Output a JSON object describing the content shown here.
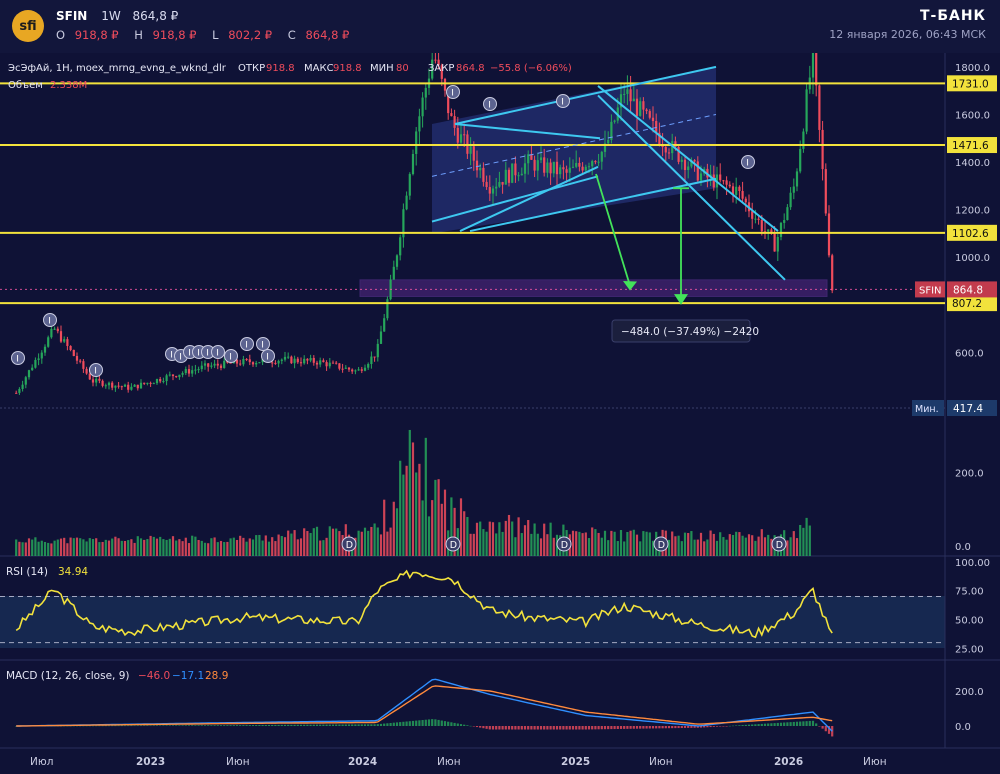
{
  "header": {
    "logo_text": "sfi",
    "symbol": "SFIN",
    "interval": "1W",
    "last_price": "864,8 ₽",
    "ohlc": [
      {
        "key": "O",
        "value": "918,8 ₽"
      },
      {
        "key": "H",
        "value": "918,8 ₽"
      },
      {
        "key": "L",
        "value": "802,2 ₽"
      },
      {
        "key": "C",
        "value": "864,8 ₽"
      }
    ],
    "brand": "Т-БАНК",
    "datetime": "12 января 2026, 06:43 МСК"
  },
  "legend": {
    "symbol_desc": "ЭсЭфАй, 1H, moex_mrng_evng_e_wknd_dlr",
    "open_label": "ОТКР",
    "open": "918.8",
    "high_label": "МАКС",
    "high": "918.8",
    "low_label": "МИН",
    "low": "80",
    "close_label": "ЗАКР",
    "close": "864.8",
    "change": "−55.8 (−6.06%)",
    "volume_label": "Объем",
    "volume": "2.338M"
  },
  "colors": {
    "background": "#0f1236",
    "up": "#26a65b",
    "down": "#ef4c5c",
    "level_line": "#f2e23c",
    "channel": "#3ec8f0",
    "target_arrow": "#43e35a",
    "zone": "#9b3fd4",
    "rsi_line": "#f2e23c",
    "macd_line": "#2f8fff",
    "signal_line": "#ff8a3d"
  },
  "chart_data": [
    {
      "type": "line",
      "title": "",
      "panel": "price",
      "ylim": [
        400,
        1850
      ],
      "y_ticks": [
        600.0,
        800.0,
        1000.0,
        1200.0,
        1400.0,
        1600.0,
        1800.0
      ],
      "x_ticks": [
        "Июл",
        "2023",
        "Июн",
        "2024",
        "Июн",
        "2025",
        "Июн",
        "2026",
        "Июн"
      ],
      "series": [
        {
          "x": [
            "2022-06",
            "2022-08",
            "2022-10",
            "2022-12",
            "2023-02",
            "2023-04",
            "2023-06",
            "2023-08",
            "2023-10",
            "2023-12",
            "2024-01",
            "2024-02",
            "2024-03",
            "2024-04",
            "2024-05",
            "2024-07",
            "2024-09",
            "2024-11",
            "2025-01",
            "2025-02",
            "2025-04",
            "2025-06",
            "2025-08",
            "2025-10",
            "2025-11",
            "2025-12",
            "2026-01"
          ],
          "y": [
            430,
            700,
            480,
            450,
            500,
            540,
            560,
            570,
            560,
            520,
            600,
            1000,
            1500,
            1860,
            1560,
            1300,
            1400,
            1350,
            1450,
            1700,
            1500,
            1350,
            1280,
            1050,
            1300,
            1850,
            864.8
          ]
        }
      ],
      "levels": [
        {
          "value": 1731.0,
          "label": "1731.0"
        },
        {
          "value": 1471.6,
          "label": "1471.6"
        },
        {
          "value": 1102.6,
          "label": "1102.6"
        },
        {
          "value": 807.2,
          "label": "807.2"
        }
      ],
      "last_price_tag": {
        "label": "SFIN",
        "value": 864.8,
        "value_label": "864.8"
      },
      "min_tag": {
        "label": "Мин.",
        "value": 417.4,
        "value_label": "417.4"
      },
      "measure_label": "−484.0 (−37.49%) −2420",
      "event_markers": [
        "I",
        "D"
      ]
    },
    {
      "type": "bar",
      "title": "",
      "panel": "volume",
      "y_ticks": [
        0.0,
        200.0
      ],
      "series": [
        {
          "x": [
            "2022-06",
            "2023-06",
            "2024-01",
            "2024-03",
            "2024-05",
            "2024-09",
            "2025-01",
            "2025-06",
            "2025-11",
            "2025-12"
          ],
          "y": [
            20,
            25,
            60,
            300,
            120,
            60,
            40,
            35,
            40,
            80
          ]
        }
      ]
    },
    {
      "type": "line",
      "title": "",
      "panel": "rsi",
      "label": "RSI (14)",
      "current": "34.94",
      "ylim": [
        15,
        105
      ],
      "y_ticks": [
        25.0,
        50.0,
        75.0,
        100.0
      ],
      "bands": [
        30,
        70
      ],
      "series": [
        {
          "x": [
            "2022-06",
            "2022-08",
            "2022-10",
            "2022-12",
            "2023-06",
            "2023-12",
            "2024-01",
            "2024-03",
            "2024-05",
            "2024-07",
            "2024-09",
            "2024-12",
            "2025-02",
            "2025-06",
            "2025-09",
            "2025-11",
            "2025-12",
            "2026-01"
          ],
          "y": [
            42,
            76,
            44,
            40,
            52,
            48,
            75,
            92,
            86,
            58,
            52,
            48,
            62,
            46,
            38,
            56,
            76,
            35
          ]
        }
      ]
    },
    {
      "type": "line",
      "title": "",
      "panel": "macd",
      "label": "MACD (12, 26, close, 9)",
      "values": {
        "histogram": "−46.0",
        "macd": "−17.1",
        "signal": "28.9"
      },
      "y_ticks": [
        0.0,
        200.0
      ],
      "series": [
        {
          "x": [
            "2022-06",
            "2023-06",
            "2024-01",
            "2024-04",
            "2024-07",
            "2024-12",
            "2025-06",
            "2025-12",
            "2026-01"
          ],
          "y": [
            0,
            20,
            30,
            270,
            180,
            60,
            0,
            80,
            -30
          ]
        },
        {
          "x": [
            "2022-06",
            "2023-06",
            "2024-01",
            "2024-04",
            "2024-07",
            "2024-12",
            "2025-06",
            "2025-12",
            "2026-01"
          ],
          "y": [
            0,
            15,
            20,
            230,
            200,
            80,
            10,
            50,
            30
          ]
        }
      ]
    }
  ]
}
